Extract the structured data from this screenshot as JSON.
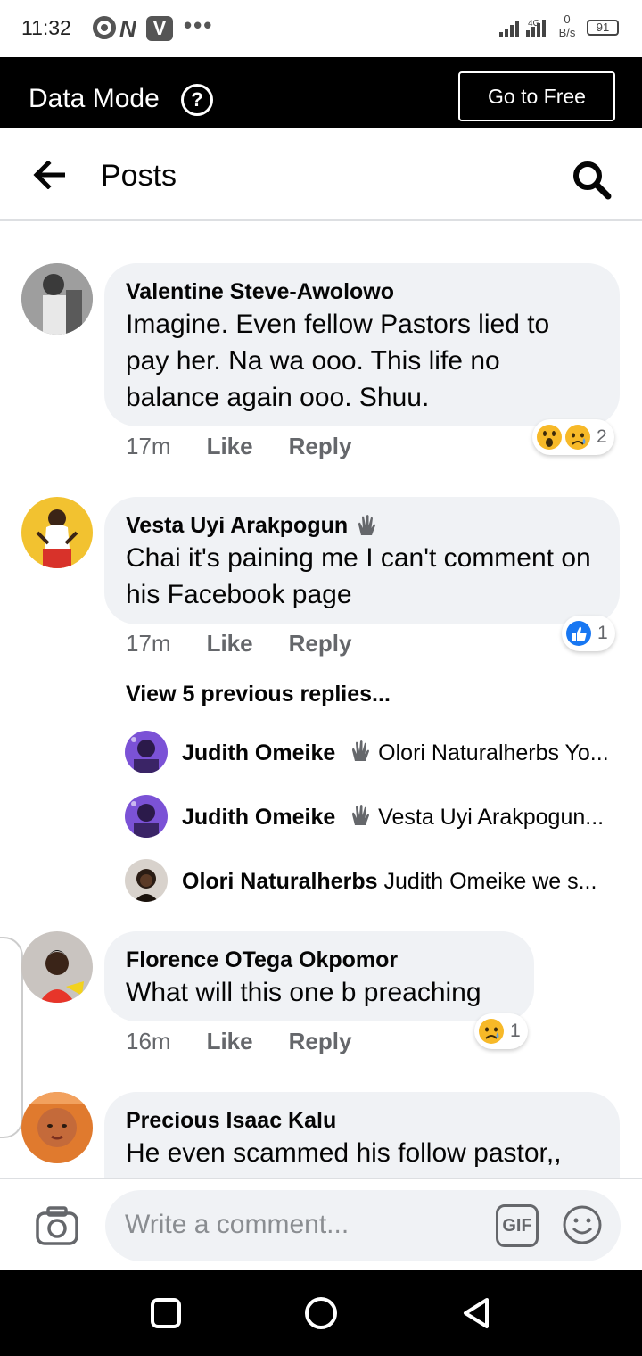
{
  "status_bar": {
    "time": "11:32",
    "network": "4G",
    "speed_value": "0",
    "speed_unit": "B/s",
    "battery": "91"
  },
  "data_mode": {
    "title": "Data Mode",
    "help_glyph": "?",
    "button_label": "Go to Free"
  },
  "header": {
    "title": "Posts"
  },
  "comments": [
    {
      "author": "Valentine Steve-Awolowo",
      "verified_wave": false,
      "text": "Imagine. Even fellow Pastors lied to pay her. Na wa ooo. This life no balance again ooo. Shuu.",
      "time": "17m",
      "like_label": "Like",
      "reply_label": "Reply",
      "reactions": [
        "wow-icon",
        "sad-icon"
      ],
      "reaction_count": "2"
    },
    {
      "author": "Vesta Uyi Arakpogun",
      "verified_wave": true,
      "text": "Chai it's paining me I can't comment on his Facebook page",
      "time": "17m",
      "like_label": "Like",
      "reply_label": "Reply",
      "reactions": [
        "like-icon"
      ],
      "reaction_count": "1",
      "view_replies": "View 5 previous replies...",
      "replies": [
        {
          "author": "Judith Omeike",
          "wave": true,
          "text": "Olori Naturalherbs Yo..."
        },
        {
          "author": "Judith Omeike",
          "wave": true,
          "text": "Vesta Uyi Arakpogun..."
        },
        {
          "author": "Olori Naturalherbs",
          "wave": false,
          "text": "Judith Omeike we s..."
        }
      ]
    },
    {
      "author": "Florence OTega Okpomor",
      "verified_wave": false,
      "text": "What will this one b preaching",
      "time": "16m",
      "like_label": "Like",
      "reply_label": "Reply",
      "reactions": [
        "sad-icon"
      ],
      "reaction_count": "1"
    },
    {
      "author": "Precious Isaac Kalu",
      "verified_wave": false,
      "text": "He even scammed his follow pastor,,"
    }
  ],
  "composer": {
    "placeholder": "Write a comment...",
    "gif_label": "GIF"
  },
  "colors": {
    "bubble": "#f0f2f5",
    "meta_text": "#65676b",
    "like_blue": "#1877f2",
    "emoji_yellow": "#f7b928"
  }
}
